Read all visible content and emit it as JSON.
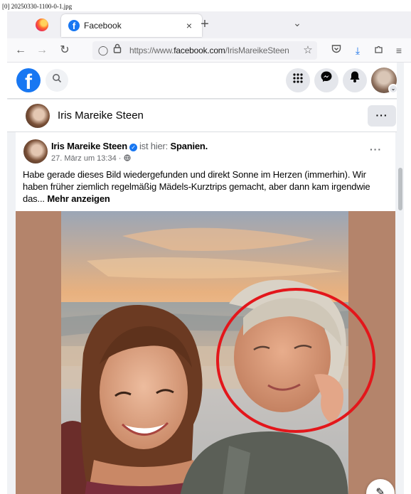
{
  "caption": "[0] 20250330-1100-0-1.jpg",
  "browser": {
    "tab_title": "Facebook",
    "tab_close": "×",
    "new_tab": "+",
    "tab_list": "⌄",
    "url_prefix": "https://www.",
    "url_domain": "facebook.com",
    "url_path": "/IrisMareikeSteen"
  },
  "profile_bar": {
    "name": "Iris Mareike Steen",
    "more": "···"
  },
  "post": {
    "author": "Iris Mareike Steen",
    "is_here": "ist hier:",
    "place": "Spanien.",
    "date": "27. März um 13:34 ·",
    "more": "···",
    "text": "Habe gerade dieses Bild wiedergefunden und direkt Sonne im Herzen (immerhin). Wir haben früher ziemlich regelmäßig Mädels-Kurztrips gemacht, aber dann kam irgendwie das...",
    "see_more": "Mehr anzeigen"
  },
  "colors": {
    "brand": "#1877f2",
    "highlight_circle": "#e3161b"
  },
  "icons": [
    "firefox-icon",
    "facebook-favicon-icon",
    "back-icon",
    "forward-icon",
    "reload-icon",
    "tracking-shield-icon",
    "lock-icon",
    "bookmark-star-icon",
    "pocket-icon",
    "download-icon",
    "extensions-icon",
    "menu-icon",
    "facebook-logo-icon",
    "search-icon",
    "apps-grid-icon",
    "messenger-icon",
    "bell-icon",
    "globe-icon",
    "edit-icon"
  ]
}
